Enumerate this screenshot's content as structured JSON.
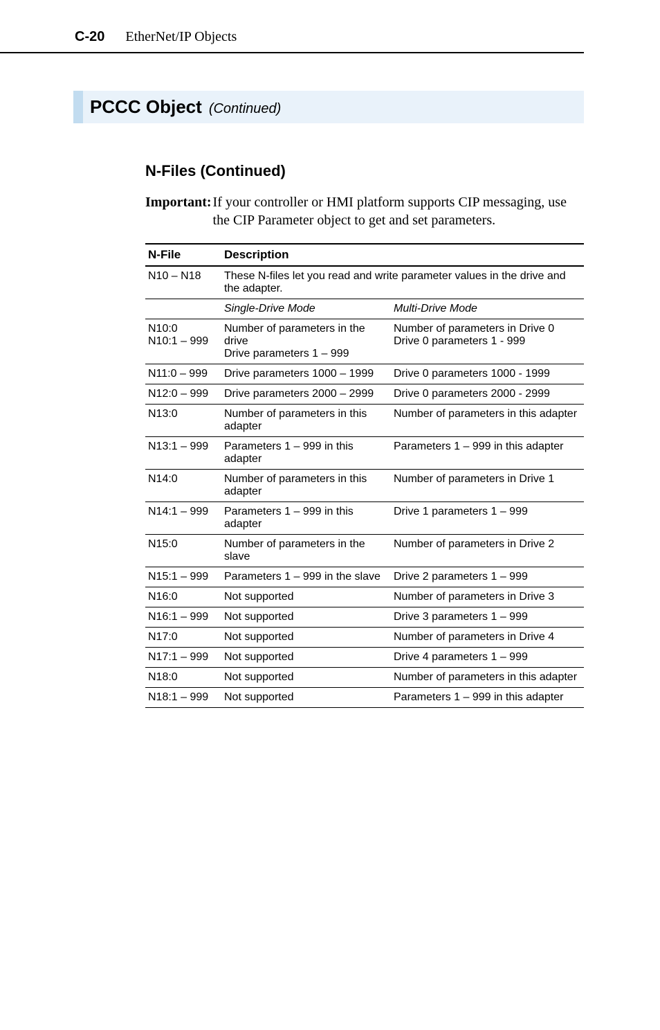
{
  "header": {
    "section_num": "C-20",
    "section_title": "EtherNet/IP Objects"
  },
  "pccc": {
    "title": "PCCC Object",
    "continued": "(Continued)"
  },
  "nfiles": {
    "heading": "N-Files (Continued)",
    "important_label": "Important:",
    "important_text": "If your controller or HMI platform supports CIP messaging, use the CIP Parameter object to get and set parameters."
  },
  "table": {
    "col1": "N-File",
    "col2": "Description",
    "row_range": "N10 – N18",
    "row_range_desc": "These N-files let you read and write parameter values in the drive and the adapter.",
    "mode_single": "Single-Drive Mode",
    "mode_multi": "Multi-Drive Mode",
    "rows": [
      {
        "nf": "N10:0\nN10:1 – 999",
        "single": "Number of parameters in the drive\nDrive parameters 1 – 999",
        "multi": "Number of parameters in Drive 0\nDrive 0 parameters 1 - 999"
      },
      {
        "nf": "N11:0 – 999",
        "single": "Drive parameters 1000 – 1999",
        "multi": "Drive 0 parameters 1000 - 1999"
      },
      {
        "nf": "N12:0 – 999",
        "single": "Drive parameters 2000 – 2999",
        "multi": "Drive 0 parameters 2000 - 2999"
      },
      {
        "nf": "N13:0",
        "single": "Number of parameters in this adapter",
        "multi": "Number of parameters in this adapter"
      },
      {
        "nf": "N13:1 – 999",
        "single": "Parameters 1 – 999 in this adapter",
        "multi": "Parameters 1 – 999 in this adapter"
      },
      {
        "nf": "N14:0",
        "single": "Number of parameters in this adapter",
        "multi": "Number of parameters in Drive 1"
      },
      {
        "nf": "N14:1 – 999",
        "single": "Parameters 1 – 999 in this adapter",
        "multi": "Drive 1 parameters 1 – 999"
      },
      {
        "nf": "N15:0",
        "single": "Number of parameters in the slave",
        "multi": "Number of parameters in Drive 2"
      },
      {
        "nf": "N15:1 – 999",
        "single": "Parameters 1 – 999 in the slave",
        "multi": "Drive 2 parameters 1 – 999"
      },
      {
        "nf": "N16:0",
        "single": "Not supported",
        "multi": "Number of parameters in Drive 3"
      },
      {
        "nf": "N16:1 – 999",
        "single": "Not supported",
        "multi": "Drive 3 parameters 1 – 999"
      },
      {
        "nf": "N17:0",
        "single": "Not supported",
        "multi": "Number of parameters in Drive 4"
      },
      {
        "nf": "N17:1 – 999",
        "single": "Not supported",
        "multi": "Drive 4 parameters 1 – 999"
      },
      {
        "nf": "N18:0",
        "single": "Not supported",
        "multi": "Number of parameters in this adapter"
      },
      {
        "nf": "N18:1 – 999",
        "single": "Not supported",
        "multi": "Parameters 1 – 999 in this adapter"
      }
    ]
  }
}
